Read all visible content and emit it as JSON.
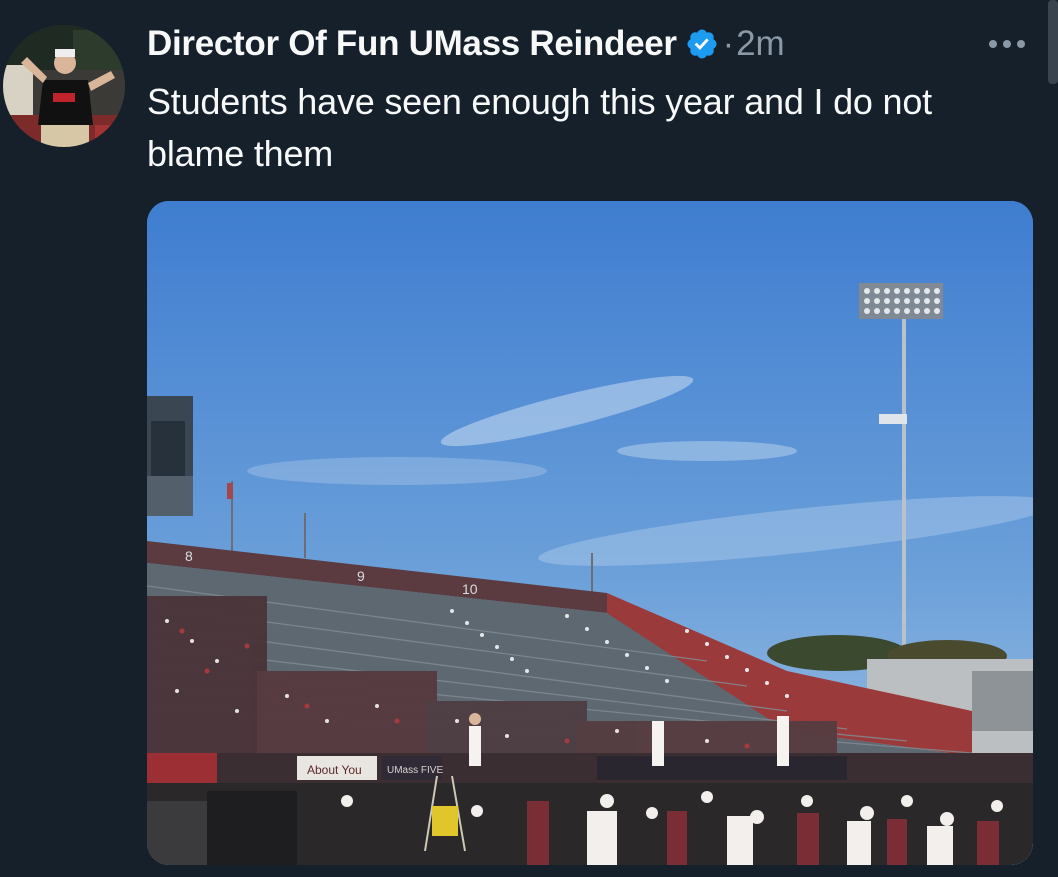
{
  "tweet": {
    "display_name": "Director Of Fun UMass Reindeer",
    "verified": true,
    "separator": "·",
    "timestamp": "2m",
    "text": "Students have seen enough this year and I do not blame them",
    "more_icon": "more-horizontal-icon",
    "verified_icon": "verified-badge-icon"
  },
  "media": {
    "scoreboard_section_numbers": [
      "8",
      "9",
      "10"
    ],
    "banner_text": [
      "About You",
      "UMass FIVE"
    ]
  },
  "colors": {
    "background": "#15202b",
    "text_primary": "#f7f9f9",
    "text_secondary": "#8b98a5",
    "verified_blue": "#1d9bf0",
    "umass_maroon": "#881c1c"
  }
}
